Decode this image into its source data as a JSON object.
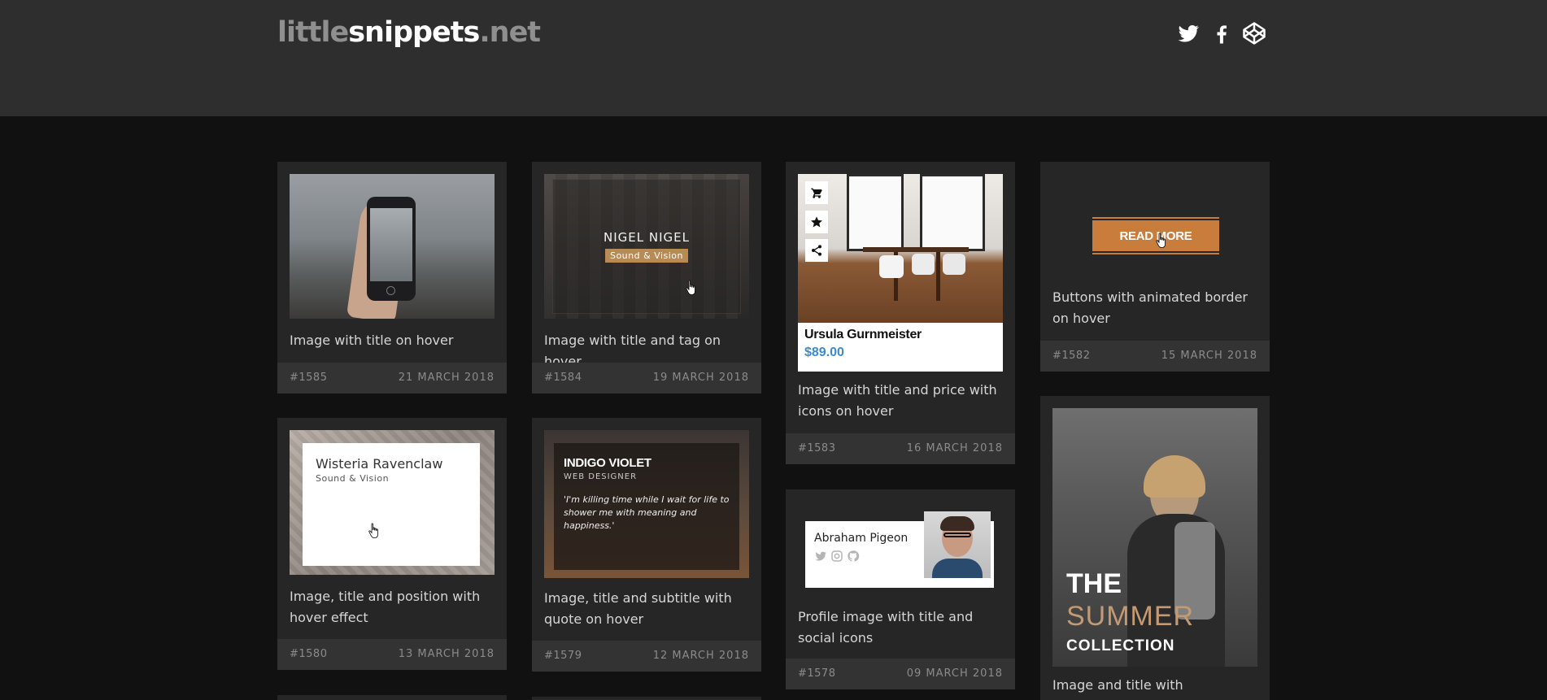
{
  "site": {
    "logo_part1": "little",
    "logo_part2": "snippets",
    "logo_part3": ".net",
    "social": [
      "twitter-icon",
      "facebook-icon",
      "codepen-icon"
    ]
  },
  "cards": [
    {
      "title": "Image with title on hover",
      "id": "#1585",
      "date": "21 MARCH 2018"
    },
    {
      "title": "Image with title and tag on hover",
      "id": "#1584",
      "date": "19 MARCH 2018",
      "overlay_title": "NIGEL NIGEL",
      "overlay_tag": "Sound & Vision"
    },
    {
      "title": "Image with title and price with icons on hover",
      "id": "#1583",
      "date": "16 MARCH 2018",
      "product_name": "Ursula Gurnmeister",
      "product_price": "$89.00"
    },
    {
      "title": "Buttons with animated border on hover",
      "id": "#1582",
      "date": "15 MARCH 2018",
      "button_label": "READ MORE"
    },
    {
      "title": "Image, title and position with hover effect",
      "id": "#1580",
      "date": "13 MARCH 2018",
      "overlay_name": "Wisteria Ravenclaw",
      "overlay_position": "Sound & Vision"
    },
    {
      "title": "Image, title and subtitle with quote on hover",
      "id": "#1579",
      "date": "12 MARCH 2018",
      "overlay_name": "INDIGO VIOLET",
      "overlay_role": "WEB DESIGNER",
      "overlay_quote": "'I'm killing time while I wait for life to shower me with meaning and happiness.'"
    },
    {
      "title": "Profile image with title and social icons",
      "id": "#1578",
      "date": "09 MARCH 2018",
      "profile_name": "Abraham Pigeon"
    },
    {
      "title": "Image and title with scale/rotate",
      "overlay_line1": "THE",
      "overlay_line2": "SUMMER",
      "overlay_line3": "COLLECTION"
    }
  ],
  "colors": {
    "header_bg": "#2e2e2e",
    "page_bg": "#111111",
    "card_bg": "#262626",
    "card_footer_bg": "#333333",
    "accent_orange": "#c87d3c",
    "tag_gold": "#b98a54",
    "price_blue": "#3d8bcd"
  }
}
